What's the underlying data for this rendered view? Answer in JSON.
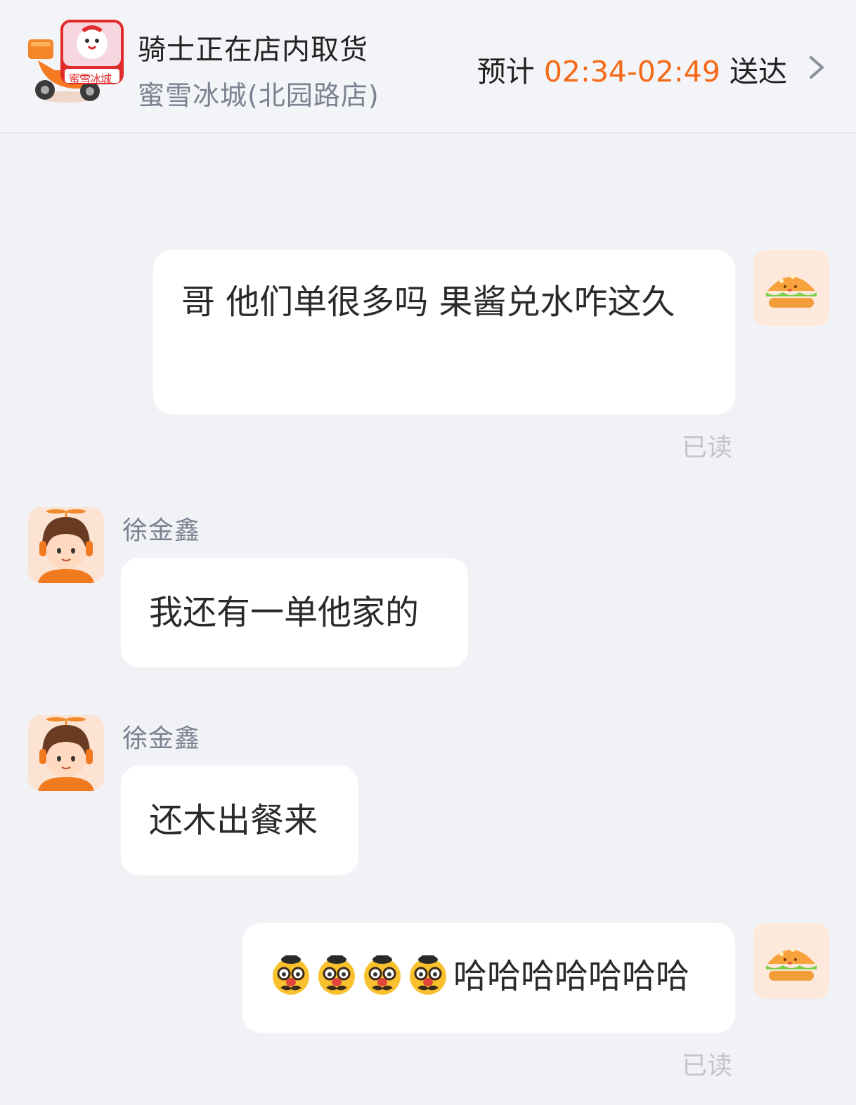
{
  "header": {
    "status": "骑士正在店内取货",
    "store_name": "蜜雪冰城(北园路店)",
    "eta_prefix": "预计",
    "eta_time": "02:34-02:49",
    "eta_suffix": "送达",
    "logo_text": "蜜雪冰城",
    "accent_color": "#f46a17"
  },
  "messages": [
    {
      "side": "right",
      "text": "哥 他们单很多吗 果酱兑水咋这久",
      "status": "已读",
      "avatar": "burger-icon"
    },
    {
      "side": "left",
      "sender": "徐金鑫",
      "text": "我还有一单他家的",
      "avatar": "rider-avatar"
    },
    {
      "side": "left",
      "sender": "徐金鑫",
      "text": "还木出餐来",
      "avatar": "rider-avatar"
    },
    {
      "side": "right",
      "emoji": "disguised-face-icon",
      "emoji_count": 4,
      "text": "哈哈哈哈哈哈哈",
      "status": "已读",
      "avatar": "burger-icon"
    }
  ]
}
